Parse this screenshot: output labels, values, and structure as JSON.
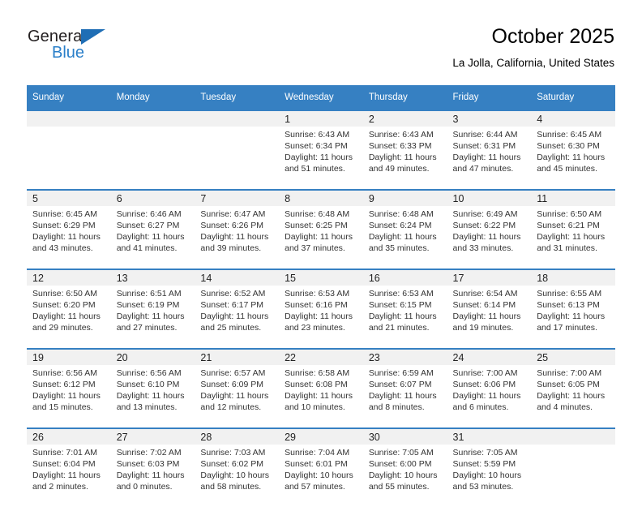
{
  "brand": {
    "word_top": "General",
    "word_bottom": "Blue",
    "accent_color": "#2a7fc9",
    "triangle_color": "#1f6eb5",
    "logo_icon": "general-blue-triangle-logo"
  },
  "header": {
    "title": "October 2025",
    "subtitle": "La Jolla, California, United States"
  },
  "theme": {
    "header_bg": "#3680c2",
    "header_text": "#ffffff",
    "date_band_bg": "#f1f1f1",
    "cell_bg": "#ffffff",
    "row_divider": "#3680c2",
    "body_text": "#333333"
  },
  "weekday_headers": [
    "Sunday",
    "Monday",
    "Tuesday",
    "Wednesday",
    "Thursday",
    "Friday",
    "Saturday"
  ],
  "labels": {
    "sunrise_prefix": "Sunrise:",
    "sunset_prefix": "Sunset:",
    "daylight_prefix": "Daylight:"
  },
  "weeks": [
    {
      "days": [
        {
          "date": "",
          "empty": true,
          "sunrise": "",
          "sunset": "",
          "daylight_line1": "",
          "daylight_line2": ""
        },
        {
          "date": "",
          "empty": true,
          "sunrise": "",
          "sunset": "",
          "daylight_line1": "",
          "daylight_line2": ""
        },
        {
          "date": "",
          "empty": true,
          "sunrise": "",
          "sunset": "",
          "daylight_line1": "",
          "daylight_line2": ""
        },
        {
          "date": "1",
          "empty": false,
          "sunrise": "Sunrise: 6:43 AM",
          "sunset": "Sunset: 6:34 PM",
          "daylight_line1": "Daylight: 11 hours",
          "daylight_line2": "and 51 minutes."
        },
        {
          "date": "2",
          "empty": false,
          "sunrise": "Sunrise: 6:43 AM",
          "sunset": "Sunset: 6:33 PM",
          "daylight_line1": "Daylight: 11 hours",
          "daylight_line2": "and 49 minutes."
        },
        {
          "date": "3",
          "empty": false,
          "sunrise": "Sunrise: 6:44 AM",
          "sunset": "Sunset: 6:31 PM",
          "daylight_line1": "Daylight: 11 hours",
          "daylight_line2": "and 47 minutes."
        },
        {
          "date": "4",
          "empty": false,
          "sunrise": "Sunrise: 6:45 AM",
          "sunset": "Sunset: 6:30 PM",
          "daylight_line1": "Daylight: 11 hours",
          "daylight_line2": "and 45 minutes."
        }
      ]
    },
    {
      "days": [
        {
          "date": "5",
          "empty": false,
          "sunrise": "Sunrise: 6:45 AM",
          "sunset": "Sunset: 6:29 PM",
          "daylight_line1": "Daylight: 11 hours",
          "daylight_line2": "and 43 minutes."
        },
        {
          "date": "6",
          "empty": false,
          "sunrise": "Sunrise: 6:46 AM",
          "sunset": "Sunset: 6:27 PM",
          "daylight_line1": "Daylight: 11 hours",
          "daylight_line2": "and 41 minutes."
        },
        {
          "date": "7",
          "empty": false,
          "sunrise": "Sunrise: 6:47 AM",
          "sunset": "Sunset: 6:26 PM",
          "daylight_line1": "Daylight: 11 hours",
          "daylight_line2": "and 39 minutes."
        },
        {
          "date": "8",
          "empty": false,
          "sunrise": "Sunrise: 6:48 AM",
          "sunset": "Sunset: 6:25 PM",
          "daylight_line1": "Daylight: 11 hours",
          "daylight_line2": "and 37 minutes."
        },
        {
          "date": "9",
          "empty": false,
          "sunrise": "Sunrise: 6:48 AM",
          "sunset": "Sunset: 6:24 PM",
          "daylight_line1": "Daylight: 11 hours",
          "daylight_line2": "and 35 minutes."
        },
        {
          "date": "10",
          "empty": false,
          "sunrise": "Sunrise: 6:49 AM",
          "sunset": "Sunset: 6:22 PM",
          "daylight_line1": "Daylight: 11 hours",
          "daylight_line2": "and 33 minutes."
        },
        {
          "date": "11",
          "empty": false,
          "sunrise": "Sunrise: 6:50 AM",
          "sunset": "Sunset: 6:21 PM",
          "daylight_line1": "Daylight: 11 hours",
          "daylight_line2": "and 31 minutes."
        }
      ]
    },
    {
      "days": [
        {
          "date": "12",
          "empty": false,
          "sunrise": "Sunrise: 6:50 AM",
          "sunset": "Sunset: 6:20 PM",
          "daylight_line1": "Daylight: 11 hours",
          "daylight_line2": "and 29 minutes."
        },
        {
          "date": "13",
          "empty": false,
          "sunrise": "Sunrise: 6:51 AM",
          "sunset": "Sunset: 6:19 PM",
          "daylight_line1": "Daylight: 11 hours",
          "daylight_line2": "and 27 minutes."
        },
        {
          "date": "14",
          "empty": false,
          "sunrise": "Sunrise: 6:52 AM",
          "sunset": "Sunset: 6:17 PM",
          "daylight_line1": "Daylight: 11 hours",
          "daylight_line2": "and 25 minutes."
        },
        {
          "date": "15",
          "empty": false,
          "sunrise": "Sunrise: 6:53 AM",
          "sunset": "Sunset: 6:16 PM",
          "daylight_line1": "Daylight: 11 hours",
          "daylight_line2": "and 23 minutes."
        },
        {
          "date": "16",
          "empty": false,
          "sunrise": "Sunrise: 6:53 AM",
          "sunset": "Sunset: 6:15 PM",
          "daylight_line1": "Daylight: 11 hours",
          "daylight_line2": "and 21 minutes."
        },
        {
          "date": "17",
          "empty": false,
          "sunrise": "Sunrise: 6:54 AM",
          "sunset": "Sunset: 6:14 PM",
          "daylight_line1": "Daylight: 11 hours",
          "daylight_line2": "and 19 minutes."
        },
        {
          "date": "18",
          "empty": false,
          "sunrise": "Sunrise: 6:55 AM",
          "sunset": "Sunset: 6:13 PM",
          "daylight_line1": "Daylight: 11 hours",
          "daylight_line2": "and 17 minutes."
        }
      ]
    },
    {
      "days": [
        {
          "date": "19",
          "empty": false,
          "sunrise": "Sunrise: 6:56 AM",
          "sunset": "Sunset: 6:12 PM",
          "daylight_line1": "Daylight: 11 hours",
          "daylight_line2": "and 15 minutes."
        },
        {
          "date": "20",
          "empty": false,
          "sunrise": "Sunrise: 6:56 AM",
          "sunset": "Sunset: 6:10 PM",
          "daylight_line1": "Daylight: 11 hours",
          "daylight_line2": "and 13 minutes."
        },
        {
          "date": "21",
          "empty": false,
          "sunrise": "Sunrise: 6:57 AM",
          "sunset": "Sunset: 6:09 PM",
          "daylight_line1": "Daylight: 11 hours",
          "daylight_line2": "and 12 minutes."
        },
        {
          "date": "22",
          "empty": false,
          "sunrise": "Sunrise: 6:58 AM",
          "sunset": "Sunset: 6:08 PM",
          "daylight_line1": "Daylight: 11 hours",
          "daylight_line2": "and 10 minutes."
        },
        {
          "date": "23",
          "empty": false,
          "sunrise": "Sunrise: 6:59 AM",
          "sunset": "Sunset: 6:07 PM",
          "daylight_line1": "Daylight: 11 hours",
          "daylight_line2": "and 8 minutes."
        },
        {
          "date": "24",
          "empty": false,
          "sunrise": "Sunrise: 7:00 AM",
          "sunset": "Sunset: 6:06 PM",
          "daylight_line1": "Daylight: 11 hours",
          "daylight_line2": "and 6 minutes."
        },
        {
          "date": "25",
          "empty": false,
          "sunrise": "Sunrise: 7:00 AM",
          "sunset": "Sunset: 6:05 PM",
          "daylight_line1": "Daylight: 11 hours",
          "daylight_line2": "and 4 minutes."
        }
      ]
    },
    {
      "days": [
        {
          "date": "26",
          "empty": false,
          "sunrise": "Sunrise: 7:01 AM",
          "sunset": "Sunset: 6:04 PM",
          "daylight_line1": "Daylight: 11 hours",
          "daylight_line2": "and 2 minutes."
        },
        {
          "date": "27",
          "empty": false,
          "sunrise": "Sunrise: 7:02 AM",
          "sunset": "Sunset: 6:03 PM",
          "daylight_line1": "Daylight: 11 hours",
          "daylight_line2": "and 0 minutes."
        },
        {
          "date": "28",
          "empty": false,
          "sunrise": "Sunrise: 7:03 AM",
          "sunset": "Sunset: 6:02 PM",
          "daylight_line1": "Daylight: 10 hours",
          "daylight_line2": "and 58 minutes."
        },
        {
          "date": "29",
          "empty": false,
          "sunrise": "Sunrise: 7:04 AM",
          "sunset": "Sunset: 6:01 PM",
          "daylight_line1": "Daylight: 10 hours",
          "daylight_line2": "and 57 minutes."
        },
        {
          "date": "30",
          "empty": false,
          "sunrise": "Sunrise: 7:05 AM",
          "sunset": "Sunset: 6:00 PM",
          "daylight_line1": "Daylight: 10 hours",
          "daylight_line2": "and 55 minutes."
        },
        {
          "date": "31",
          "empty": false,
          "sunrise": "Sunrise: 7:05 AM",
          "sunset": "Sunset: 5:59 PM",
          "daylight_line1": "Daylight: 10 hours",
          "daylight_line2": "and 53 minutes."
        },
        {
          "date": "",
          "empty": true,
          "sunrise": "",
          "sunset": "",
          "daylight_line1": "",
          "daylight_line2": ""
        }
      ]
    }
  ]
}
